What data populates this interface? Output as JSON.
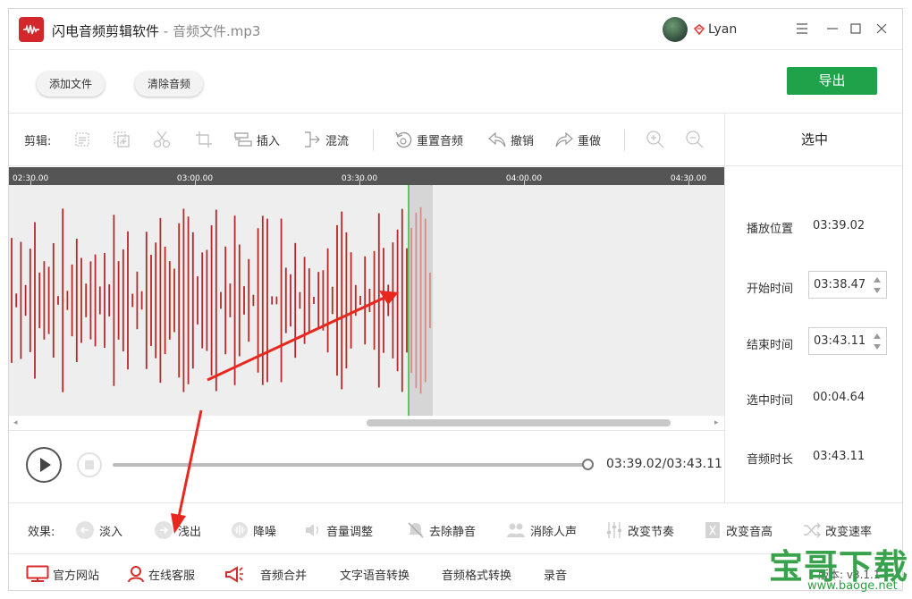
{
  "titlebar": {
    "app_name": "闪电音频剪辑软件",
    "separator": " - ",
    "file_name": "音频文件.mp3",
    "username": "Lyan"
  },
  "topbar": {
    "add_file": "添加文件",
    "clear_audio": "清除音频",
    "export": "导出"
  },
  "edit_toolbar": {
    "label": "剪辑:",
    "insert": "插入",
    "mix": "混流",
    "reset_audio": "重置音频",
    "undo": "撤销",
    "redo": "重做"
  },
  "right_panel": {
    "title": "选中",
    "play_position_label": "播放位置",
    "play_position_value": "03:39.02",
    "start_time_label": "开始时间",
    "start_time_value": "03:38.47",
    "end_time_label": "结束时间",
    "end_time_value": "03:43.11",
    "selected_time_label": "选中时间",
    "selected_time_value": "00:04.64",
    "duration_label": "音频时长",
    "duration_value": "03:43.11"
  },
  "timeline": {
    "ticks": [
      "02:30.00",
      "03:00.00",
      "03:30.00",
      "04:00.00",
      "04:30.00"
    ]
  },
  "playback": {
    "time_readout": "03:39.02/03:43.11",
    "progress": 0.9975
  },
  "effects": {
    "label": "效果:",
    "items": [
      "淡入",
      "浅出",
      "降噪",
      "音量调整",
      "去除静音",
      "消除人声",
      "改变节奏",
      "改变音高",
      "改变速率"
    ]
  },
  "bottombar": {
    "official_site": "官方网站",
    "online_support": "在线客服",
    "audio_merge": "音频合并",
    "tts": "文字语音转换",
    "format_convert": "音频格式转换",
    "record": "录音",
    "version": "版本: v3.1.1"
  },
  "watermark": {
    "brand": "宝哥下载",
    "url": "www.baoge.net"
  },
  "colors": {
    "export_green": "#1ea34a",
    "wave_red": "#b52a2a",
    "playhead_green": "#5cc85c"
  }
}
